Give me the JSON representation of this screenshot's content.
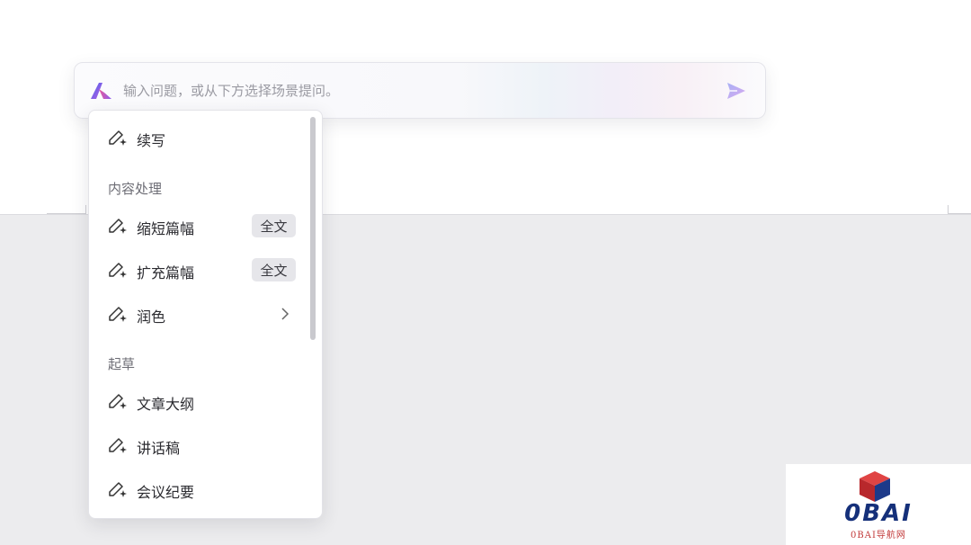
{
  "ask_bar": {
    "placeholder": "输入问题，或从下方选择场景提问。",
    "logo_icon": "app-logo-icon",
    "send_icon": "send-icon"
  },
  "menu": {
    "items": [
      {
        "label": "续写",
        "icon": "ai-pen-icon"
      },
      {
        "label": "缩短篇幅",
        "icon": "ai-pen-icon",
        "badge": "全文"
      },
      {
        "label": "扩充篇幅",
        "icon": "ai-pen-icon",
        "badge": "全文"
      },
      {
        "label": "润色",
        "icon": "ai-pen-icon",
        "submenu_icon": "chevron-right-icon"
      },
      {
        "label": "文章大纲",
        "icon": "ai-pen-icon"
      },
      {
        "label": "讲话稿",
        "icon": "ai-pen-icon"
      },
      {
        "label": "会议纪要",
        "icon": "ai-pen-icon"
      }
    ],
    "sections": {
      "content_processing": "内容处理",
      "drafting": "起草"
    }
  },
  "watermark": {
    "title": "0BAI",
    "subtitle": "0BAI导航网",
    "colors": {
      "text": "#15307a",
      "cube": "#d63a3a",
      "sub": "#c23a3a"
    }
  },
  "colors": {
    "doc_background": "#ececee",
    "accent_gradient_start": "#5b6cf0",
    "accent_gradient_end": "#c86ad8"
  }
}
